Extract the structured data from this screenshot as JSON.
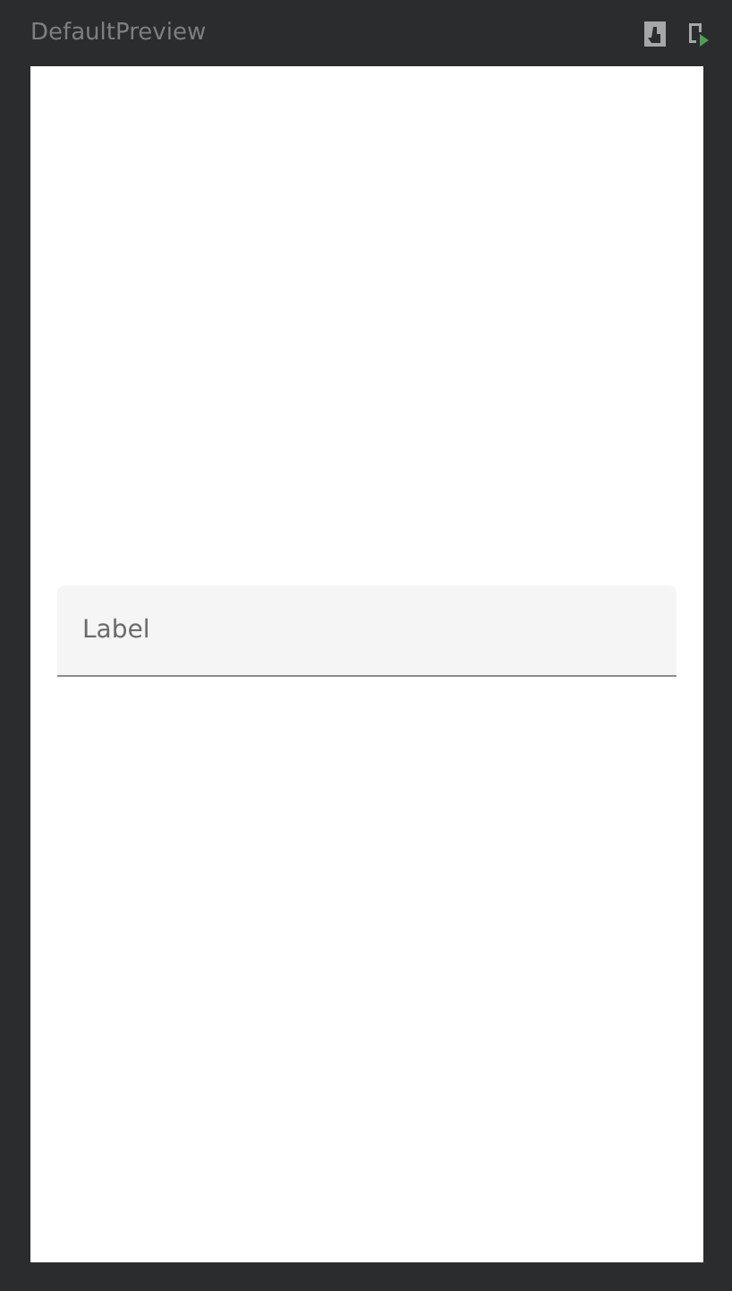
{
  "preview": {
    "title": "DefaultPreview",
    "text_field": {
      "placeholder": "Label"
    }
  }
}
